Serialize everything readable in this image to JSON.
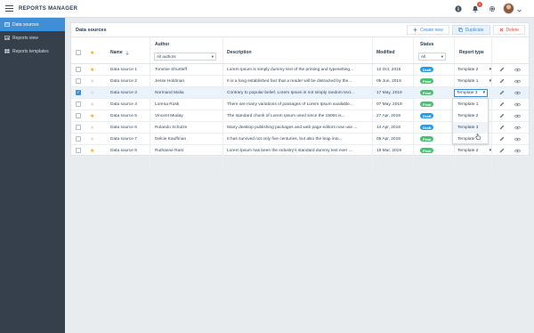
{
  "app": {
    "title": "REPORTS MANAGER",
    "notification_count": "1"
  },
  "sidebar": {
    "items": [
      {
        "label": "Data sources",
        "icon": "database-icon",
        "active": true
      },
      {
        "label": "Reports view",
        "icon": "chart-icon",
        "active": false
      },
      {
        "label": "Reports templates",
        "icon": "grid-icon",
        "active": false
      }
    ]
  },
  "main": {
    "title": "Data sources",
    "actions": {
      "create": "Create new",
      "duplicate": "Duplicate",
      "delete": "Delete"
    }
  },
  "table": {
    "headers": {
      "author": "Author",
      "name": "Name",
      "description": "Description",
      "modified": "Modified",
      "status": "Status",
      "report_type": "Report type"
    },
    "filters": {
      "author": "All authors",
      "status": "All"
    },
    "rows": [
      {
        "starred": true,
        "checked": false,
        "name": "Data source 1",
        "author": "Tommie Shurtleff",
        "description": "Lorem Ipsum is simply dummy text of the printing and typesetting...",
        "modified": "12 Oct, 2019",
        "status": "Draft",
        "report_type": "Template 2"
      },
      {
        "starred": false,
        "checked": false,
        "name": "Data source 2",
        "author": "Jesse Holdman",
        "description": "It is a long established fact that a reader will be distracted by the...",
        "modified": "05 Jun, 2019",
        "status": "Final",
        "report_type": "Template 1"
      },
      {
        "starred": false,
        "checked": true,
        "name": "Data source 3",
        "author": "Normand Malia",
        "description": "Contrary to popular belief, Lorem Ipsum is not simply random text...",
        "modified": "17 May, 2019",
        "status": "Final",
        "report_type": "Template 3"
      },
      {
        "starred": false,
        "checked": false,
        "name": "Data source 4",
        "author": "Lorena Rusk",
        "description": "There are many variations of passages of Lorem Ipsum available...",
        "modified": "07 May, 2019",
        "status": "Final",
        "report_type": ""
      },
      {
        "starred": true,
        "checked": false,
        "name": "Data source 5",
        "author": "Vincent Muday",
        "description": "The standard chunk of Lorem Ipsum used since the 1500s is...",
        "modified": "27 Apr, 2019",
        "status": "Draft",
        "report_type": ""
      },
      {
        "starred": false,
        "checked": false,
        "name": "Data source 6",
        "author": "Rolando Schulze",
        "description": "Many desktop publishing packages and web page editors now use ...",
        "modified": "14 Apr, 2019",
        "status": "Draft",
        "report_type": ""
      },
      {
        "starred": false,
        "checked": false,
        "name": "Data source 7",
        "author": "Delcie Kauffman",
        "description": "It has survived not only five centuries, but also the leap into...",
        "modified": "05 Apr, 2019",
        "status": "Final",
        "report_type": ""
      },
      {
        "starred": true,
        "checked": false,
        "name": "Data source 8",
        "author": "Ruthanne Rast",
        "description": "Lorem Ipsum has been the industry's standard dummy text ever ...",
        "modified": "18 Mar, 2019",
        "status": "Final",
        "report_type": "Template 2"
      }
    ]
  },
  "dropdown": {
    "options": [
      "Template 1",
      "Template 2",
      "Template 3",
      "Template 4"
    ],
    "hovered": "Template 3"
  },
  "colors": {
    "accent": "#3f8ed6",
    "sidebar": "#35404c",
    "final": "#4bbf73",
    "draft": "#2c9be6",
    "star": "#f3a623",
    "delete": "#e74c3c"
  }
}
